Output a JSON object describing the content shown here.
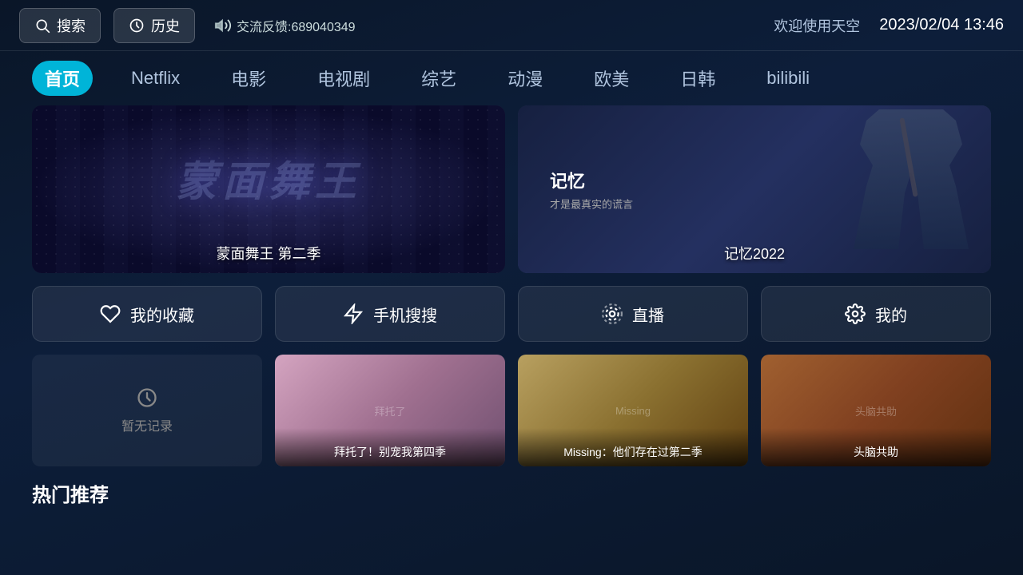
{
  "topbar": {
    "search_label": "搜索",
    "history_label": "历史",
    "feedback_label": "交流反馈:689040349",
    "welcome_label": "欢迎使用天空",
    "datetime": "2023/02/04 13:46"
  },
  "nav": {
    "items": [
      {
        "id": "home",
        "label": "首页",
        "active": true
      },
      {
        "id": "netflix",
        "label": "Netflix",
        "active": false
      },
      {
        "id": "movie",
        "label": "电影",
        "active": false
      },
      {
        "id": "tv",
        "label": "电视剧",
        "active": false
      },
      {
        "id": "variety",
        "label": "综艺",
        "active": false
      },
      {
        "id": "anime",
        "label": "动漫",
        "active": false
      },
      {
        "id": "western",
        "label": "欧美",
        "active": false
      },
      {
        "id": "korean",
        "label": "日韩",
        "active": false
      },
      {
        "id": "bilibili",
        "label": "bilibili",
        "active": false
      }
    ]
  },
  "hero": {
    "left": {
      "title": "蒙面舞王 第二季",
      "text_overlay": "蒙面舞王"
    },
    "right": {
      "title": "记忆2022",
      "subtitle_main": "记忆",
      "subtitle_sub": "才是最真实的谎言"
    }
  },
  "actions": [
    {
      "id": "favorites",
      "label": "我的收藏",
      "icon": "heart"
    },
    {
      "id": "mobile-search",
      "label": "手机搜搜",
      "icon": "bolt"
    },
    {
      "id": "live",
      "label": "直播",
      "icon": "broadcast"
    },
    {
      "id": "mine",
      "label": "我的",
      "icon": "gear"
    }
  ],
  "recent": {
    "empty_label": "暂无记录",
    "items": [
      {
        "id": "show1",
        "label": "拜托了！别宠我第四季",
        "has_image": true
      },
      {
        "id": "show2",
        "label": "Missing：他们存在过第二季",
        "has_image": true
      },
      {
        "id": "show3",
        "label": "头脑共助",
        "has_image": true
      }
    ]
  },
  "sections": [
    {
      "id": "hot",
      "label": "热门推荐"
    }
  ]
}
